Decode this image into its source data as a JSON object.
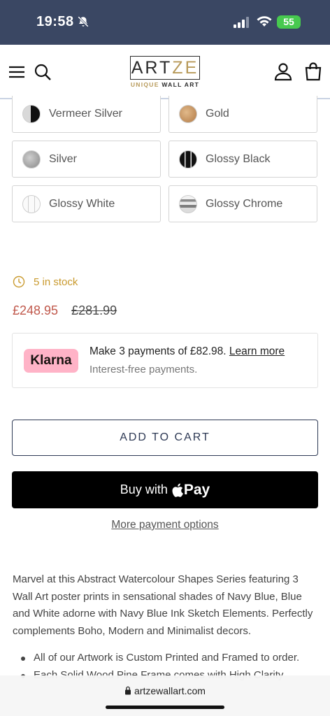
{
  "status_bar": {
    "time": "19:58",
    "battery": "55"
  },
  "header": {
    "logo_text_a": "ART",
    "logo_text_b": "ZE",
    "logo_tag_a": "UNIQUE",
    "logo_tag_b": " WALL ART"
  },
  "frame_options": [
    {
      "label": "Vermeer Silver",
      "swatch": "vermeer-silver"
    },
    {
      "label": "Gold",
      "swatch": "gold"
    },
    {
      "label": "Silver",
      "swatch": "silver"
    },
    {
      "label": "Glossy Black",
      "swatch": "glossy-black"
    },
    {
      "label": "Glossy White",
      "swatch": "glossy-white"
    },
    {
      "label": "Glossy Chrome",
      "swatch": "glossy-chrome"
    }
  ],
  "stock": {
    "text": "5 in stock"
  },
  "price": {
    "sale": "£248.95",
    "was": "£281.99"
  },
  "klarna": {
    "badge": "Klarna",
    "message": "Make 3 payments of £82.98.",
    "link": "Learn more",
    "subtext": "Interest-free payments."
  },
  "actions": {
    "add_to_cart": "ADD TO CART",
    "buy_with": "Buy with",
    "pay": "Pay",
    "more_options": "More payment options"
  },
  "description": {
    "text": "Marvel at this Abstract Watercolour Shapes Series featuring 3 Wall Art poster prints in sensational shades of Navy Blue, Blue and White adorne with Navy Blue Ink Sketch Elements. Perfectly complements Boho, Modern and Minimalist decors.",
    "bullets": [
      "All of our Artwork is Custom Printed and Framed to order.",
      "Each Solid Wood Pine Frame comes with High Clarity"
    ]
  },
  "browser": {
    "url": "artzewallart.com"
  },
  "colors": {
    "status_bar_bg": "#3a4763",
    "accent_gold": "#b89a5a",
    "sale_price": "#c0584b",
    "stock": "#c99a2e",
    "klarna_pink": "#ffb3c7"
  }
}
